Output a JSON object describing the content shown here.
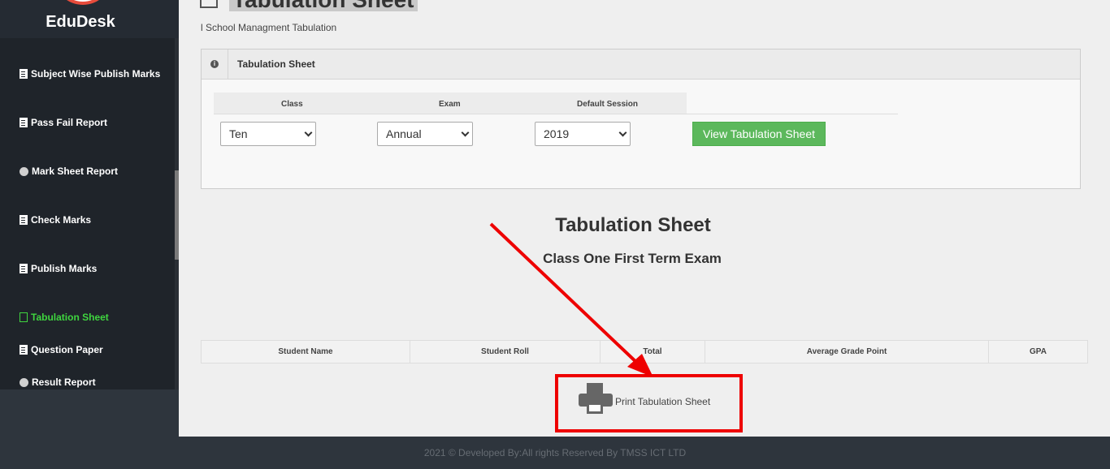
{
  "brand": {
    "name": "EduDesk"
  },
  "sidebar": {
    "items": [
      {
        "label": "Subject Wise Publish Marks",
        "icon": "document-icon",
        "active": false
      },
      {
        "label": "Pass Fail Report",
        "icon": "document-icon",
        "active": false
      },
      {
        "label": "Mark Sheet Report",
        "icon": "circle-icon",
        "active": false
      },
      {
        "label": "Check Marks",
        "icon": "document-icon",
        "active": false
      },
      {
        "label": "Publish Marks",
        "icon": "document-icon",
        "active": false
      },
      {
        "label": "Tabulation Sheet",
        "icon": "file-outline-icon",
        "active": true
      },
      {
        "label": "Question Paper",
        "icon": "file-text-icon",
        "active": false
      },
      {
        "label": "Result Report",
        "icon": "circle-icon",
        "active": false
      }
    ]
  },
  "header": {
    "title": "Tabulation Sheet",
    "subtitle": "l School Managment Tabulation"
  },
  "panel": {
    "title": "Tabulation Sheet",
    "fields": {
      "class": {
        "label": "Class",
        "value": "Ten"
      },
      "exam": {
        "label": "Exam",
        "value": "Annual"
      },
      "session": {
        "label": "Default Session",
        "value": "2019"
      }
    },
    "view_button": "View Tabulation Sheet",
    "accent": "#5cb85c"
  },
  "report": {
    "title": "Tabulation Sheet",
    "subtitle": "Class One First Term Exam"
  },
  "table": {
    "columns": [
      "Student Name",
      "Student Roll",
      "Total",
      "Average Grade Point",
      "GPA"
    ]
  },
  "print": {
    "label": "Print Tabulation Sheet",
    "icon": "printer-icon",
    "highlight": "#ee0000"
  },
  "footer": {
    "text": "2021 © Developed By:All rights Reserved By TMSS ICT LTD"
  }
}
